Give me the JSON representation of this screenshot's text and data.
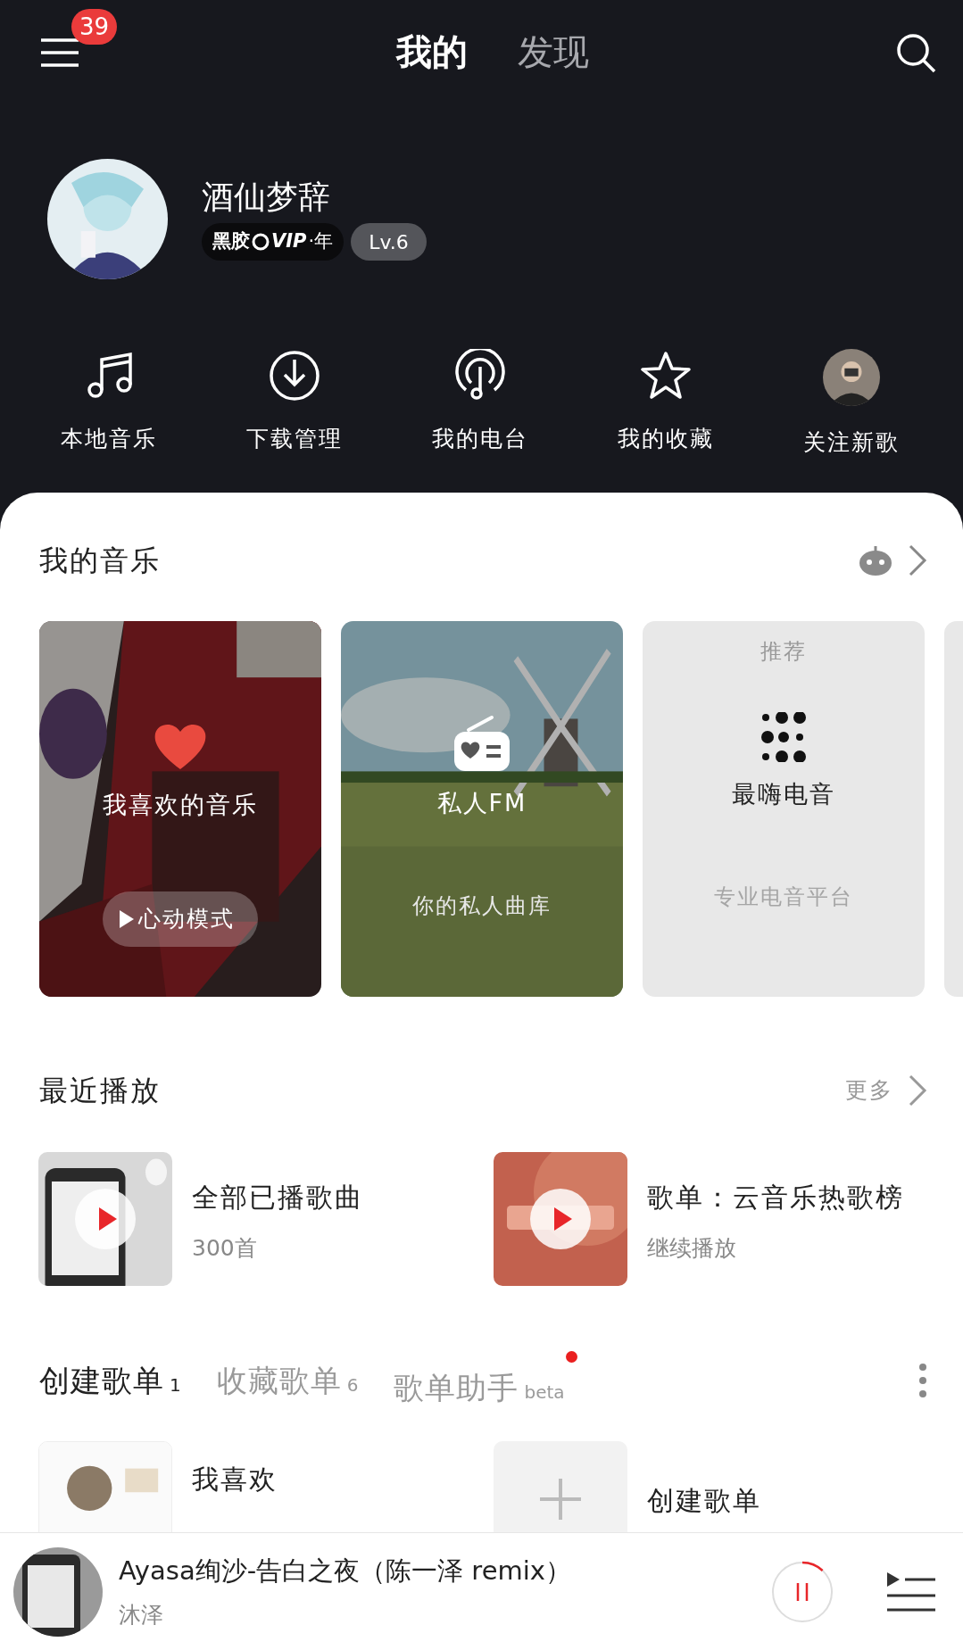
{
  "top_bar": {
    "menu_badge": "39",
    "tabs": [
      {
        "label": "我的",
        "selected": true
      },
      {
        "label": "发现",
        "selected": false
      }
    ]
  },
  "profile": {
    "name": "酒仙梦辞",
    "vip": {
      "prefix": "黑胶",
      "mark": "VIP",
      "suffix": "·年"
    },
    "level": "Lv.6"
  },
  "shortcuts": [
    {
      "kind": "music",
      "label": "本地音乐"
    },
    {
      "kind": "download",
      "label": "下载管理"
    },
    {
      "kind": "radio",
      "label": "我的电台"
    },
    {
      "kind": "star",
      "label": "我的收藏"
    },
    {
      "kind": "picture",
      "label": "关注新歌"
    }
  ],
  "my_music": {
    "title": "我的音乐",
    "cards": [
      {
        "kind": "liked",
        "title": "我喜欢的音乐",
        "button": "心动模式"
      },
      {
        "kind": "fm",
        "title": "私人FM",
        "subtitle": "你的私人曲库"
      },
      {
        "kind": "recommend",
        "tag": "推荐",
        "title": "最嗨电音",
        "subtitle": "专业电音平台"
      },
      {
        "kind": "partial"
      }
    ]
  },
  "recent": {
    "title": "最近播放",
    "more": "更多",
    "items": [
      {
        "title": "全部已播歌曲",
        "subtitle": "300首"
      },
      {
        "title": "歌单：云音乐热歌榜",
        "subtitle": "继续播放"
      }
    ]
  },
  "playlist_tabs": [
    {
      "label": "创建歌单",
      "count": "1",
      "selected": true,
      "new": false
    },
    {
      "label": "收藏歌单",
      "count": "6",
      "selected": false,
      "new": false
    },
    {
      "label": "歌单助手",
      "count": "beta",
      "selected": false,
      "new": true
    }
  ],
  "playlists": [
    {
      "kind": "picture",
      "title": "我喜欢"
    },
    {
      "kind": "create",
      "title": "创建歌单"
    }
  ],
  "player": {
    "title": "Ayasa绚沙-告白之夜（陈一泽 remix）",
    "artist": "沐泽",
    "playing": true,
    "level": 0.12
  }
}
